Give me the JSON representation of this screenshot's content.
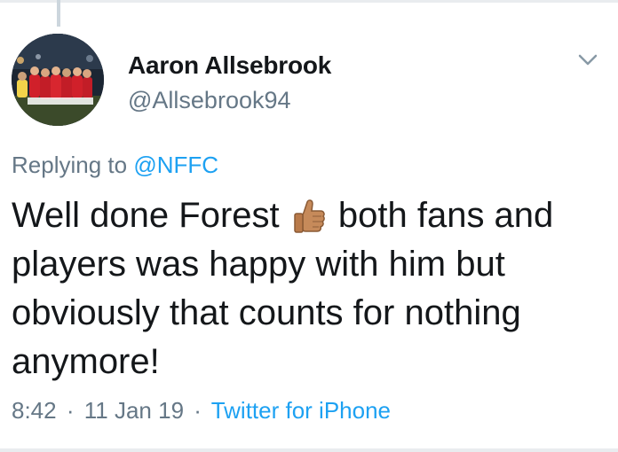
{
  "tweet": {
    "display_name": "Aaron Allsebrook",
    "handle": "@Allsebrook94",
    "replying_prefix": "Replying to",
    "replying_to": "@NFFC",
    "text_parts": [
      "Well done Forest",
      "both fans and players was happy with him but obviously that counts for nothing anymore!"
    ],
    "emoji": "thumbs-up",
    "time": "8:42",
    "date": "11 Jan 19",
    "separator": "·",
    "source": "Twitter for iPhone"
  },
  "icons": {
    "menu": "chevron-down-icon",
    "avatar": "team-photo"
  },
  "colors": {
    "link": "#1da1f2",
    "secondary_text": "#657786",
    "primary_text": "#14171a",
    "team_red": "#d0202a"
  }
}
